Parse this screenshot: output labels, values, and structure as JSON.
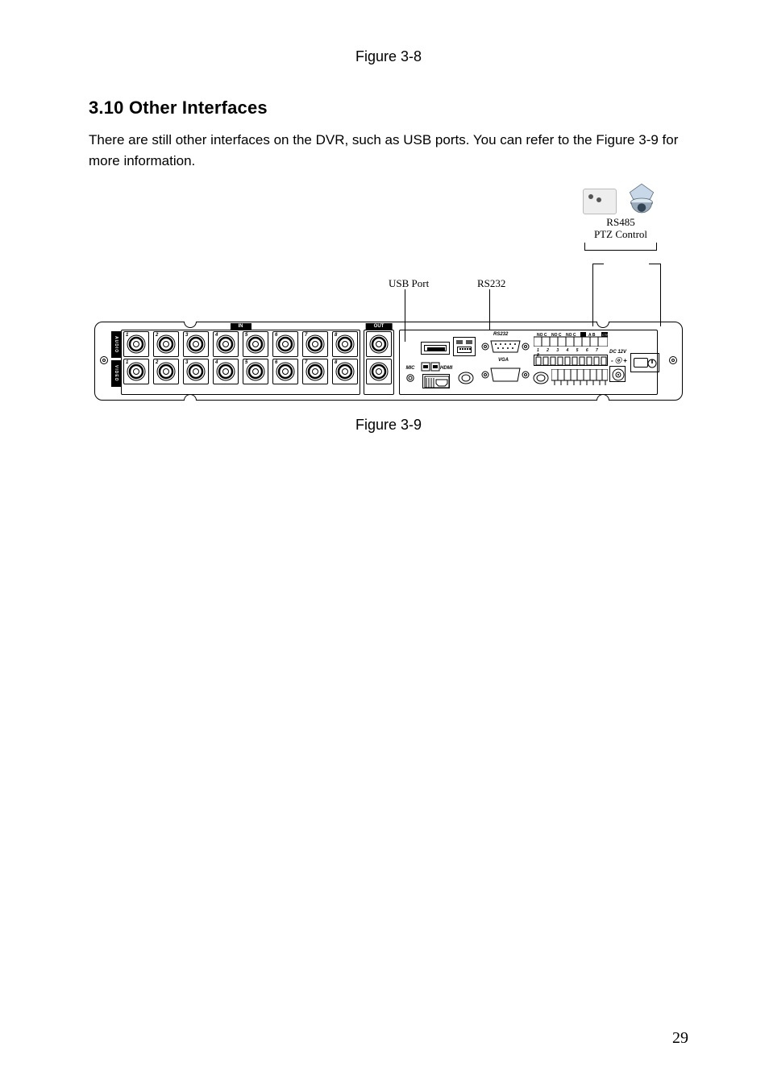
{
  "figure_top_caption": "Figure 3-8",
  "section_number": "3.10",
  "section_title": "Other Interfaces",
  "body_paragraph": "There are still other interfaces on the DVR, such as USB ports. You can refer to the Figure 3-9 for more information.",
  "diagram": {
    "callouts": {
      "usb": "USB Port",
      "rs232_top": "RS232",
      "ptz_line1": "RS485",
      "ptz_line2": "PTZ Control"
    },
    "panel": {
      "row_vert_audio": "AUDIO",
      "row_vert_video": "VIDEO",
      "in_label": "IN",
      "out_label": "OUT",
      "numbers": [
        "1",
        "2",
        "3",
        "4",
        "5",
        "6",
        "7",
        "8"
      ],
      "mic": "MIC",
      "hdmi": "HDMI",
      "rs232": "RS232",
      "vga": "VGA",
      "dc12v": "DC 12V",
      "terminal_nums": "1 2 3 4 5 6 7 8",
      "terminal_ab": "A  B",
      "ground": "G",
      "ctrl": "CTRL",
      "no_c": "NO C",
      "plus": "+",
      "on_off_sym": "⏻"
    }
  },
  "figure_bottom_caption": "Figure 3-9",
  "page_number": "29"
}
